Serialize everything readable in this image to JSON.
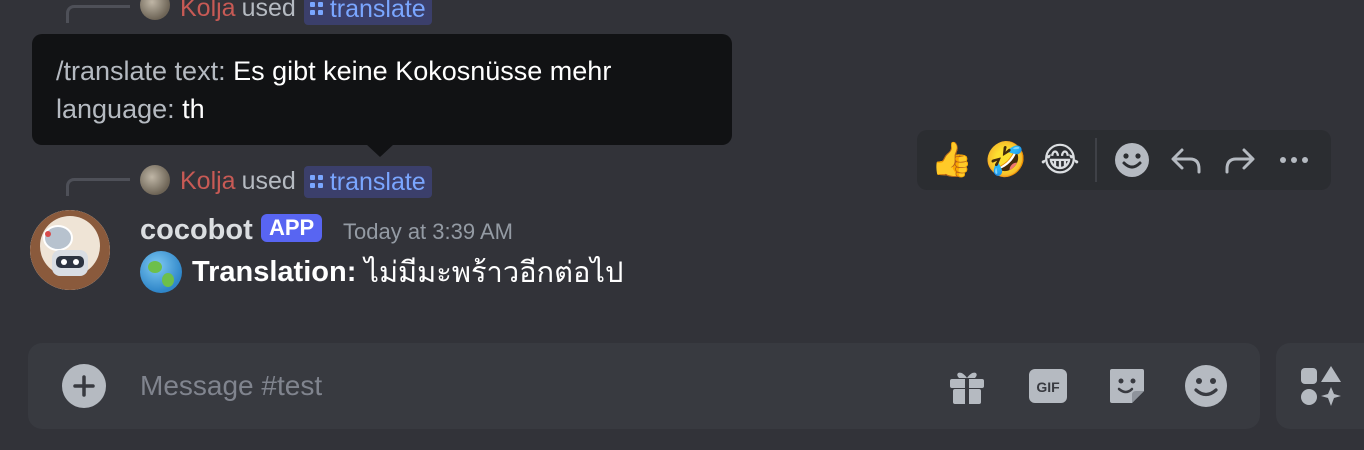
{
  "top_command": {
    "user": "Kolja",
    "used_text": "used",
    "command": "translate"
  },
  "tooltip": {
    "line1_key": "/translate text:",
    "line1_value": "Es gibt keine Kokosnüsse mehr",
    "line2_key": "language:",
    "line2_value": "th"
  },
  "command_used": {
    "user": "Kolja",
    "used_text": "used",
    "command": "translate"
  },
  "toolbar": {
    "reactions": [
      "👍",
      "🤣",
      "😂"
    ],
    "icons": [
      "add-reaction-icon",
      "reply-icon",
      "forward-icon",
      "more-icon"
    ]
  },
  "message": {
    "author": "cocobot",
    "badge": "APP",
    "timestamp": "Today at 3:39 AM",
    "label": "Translation:",
    "text": "ไม่มีมะพร้าวอีกต่อไป"
  },
  "composer": {
    "placeholder": "Message #test",
    "icons": [
      "add-icon",
      "gift-icon",
      "gif-icon",
      "sticker-icon",
      "emoji-icon",
      "apps-icon"
    ],
    "gif_label": "GIF"
  },
  "colors": {
    "background": "#323339",
    "tooltip": "#111214",
    "accent": "#5865f2",
    "command_link": "#7aa6ff",
    "username": "#c75a55"
  }
}
